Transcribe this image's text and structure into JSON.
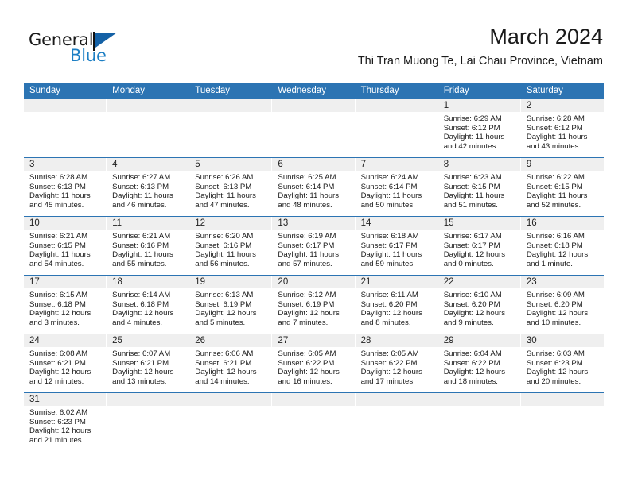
{
  "brand": {
    "name_top": "General",
    "name_bottom": "Blue",
    "accent_color": "#1d7fc4",
    "flag_color": "#1461a6"
  },
  "header": {
    "title": "March 2024",
    "subtitle": "Thi Tran Muong Te, Lai Chau Province, Vietnam",
    "header_bg": "#2c74b3",
    "daynum_bg": "#efefef"
  },
  "weekdays": [
    "Sunday",
    "Monday",
    "Tuesday",
    "Wednesday",
    "Thursday",
    "Friday",
    "Saturday"
  ],
  "weeks": [
    [
      {
        "day": "",
        "sunrise": "",
        "sunset": "",
        "daylight1": "",
        "daylight2": "",
        "empty": true
      },
      {
        "day": "",
        "sunrise": "",
        "sunset": "",
        "daylight1": "",
        "daylight2": "",
        "empty": true
      },
      {
        "day": "",
        "sunrise": "",
        "sunset": "",
        "daylight1": "",
        "daylight2": "",
        "empty": true
      },
      {
        "day": "",
        "sunrise": "",
        "sunset": "",
        "daylight1": "",
        "daylight2": "",
        "empty": true
      },
      {
        "day": "",
        "sunrise": "",
        "sunset": "",
        "daylight1": "",
        "daylight2": "",
        "empty": true
      },
      {
        "day": "1",
        "sunrise": "Sunrise: 6:29 AM",
        "sunset": "Sunset: 6:12 PM",
        "daylight1": "Daylight: 11 hours",
        "daylight2": "and 42 minutes."
      },
      {
        "day": "2",
        "sunrise": "Sunrise: 6:28 AM",
        "sunset": "Sunset: 6:12 PM",
        "daylight1": "Daylight: 11 hours",
        "daylight2": "and 43 minutes."
      }
    ],
    [
      {
        "day": "3",
        "sunrise": "Sunrise: 6:28 AM",
        "sunset": "Sunset: 6:13 PM",
        "daylight1": "Daylight: 11 hours",
        "daylight2": "and 45 minutes."
      },
      {
        "day": "4",
        "sunrise": "Sunrise: 6:27 AM",
        "sunset": "Sunset: 6:13 PM",
        "daylight1": "Daylight: 11 hours",
        "daylight2": "and 46 minutes."
      },
      {
        "day": "5",
        "sunrise": "Sunrise: 6:26 AM",
        "sunset": "Sunset: 6:13 PM",
        "daylight1": "Daylight: 11 hours",
        "daylight2": "and 47 minutes."
      },
      {
        "day": "6",
        "sunrise": "Sunrise: 6:25 AM",
        "sunset": "Sunset: 6:14 PM",
        "daylight1": "Daylight: 11 hours",
        "daylight2": "and 48 minutes."
      },
      {
        "day": "7",
        "sunrise": "Sunrise: 6:24 AM",
        "sunset": "Sunset: 6:14 PM",
        "daylight1": "Daylight: 11 hours",
        "daylight2": "and 50 minutes."
      },
      {
        "day": "8",
        "sunrise": "Sunrise: 6:23 AM",
        "sunset": "Sunset: 6:15 PM",
        "daylight1": "Daylight: 11 hours",
        "daylight2": "and 51 minutes."
      },
      {
        "day": "9",
        "sunrise": "Sunrise: 6:22 AM",
        "sunset": "Sunset: 6:15 PM",
        "daylight1": "Daylight: 11 hours",
        "daylight2": "and 52 minutes."
      }
    ],
    [
      {
        "day": "10",
        "sunrise": "Sunrise: 6:21 AM",
        "sunset": "Sunset: 6:15 PM",
        "daylight1": "Daylight: 11 hours",
        "daylight2": "and 54 minutes."
      },
      {
        "day": "11",
        "sunrise": "Sunrise: 6:21 AM",
        "sunset": "Sunset: 6:16 PM",
        "daylight1": "Daylight: 11 hours",
        "daylight2": "and 55 minutes."
      },
      {
        "day": "12",
        "sunrise": "Sunrise: 6:20 AM",
        "sunset": "Sunset: 6:16 PM",
        "daylight1": "Daylight: 11 hours",
        "daylight2": "and 56 minutes."
      },
      {
        "day": "13",
        "sunrise": "Sunrise: 6:19 AM",
        "sunset": "Sunset: 6:17 PM",
        "daylight1": "Daylight: 11 hours",
        "daylight2": "and 57 minutes."
      },
      {
        "day": "14",
        "sunrise": "Sunrise: 6:18 AM",
        "sunset": "Sunset: 6:17 PM",
        "daylight1": "Daylight: 11 hours",
        "daylight2": "and 59 minutes."
      },
      {
        "day": "15",
        "sunrise": "Sunrise: 6:17 AM",
        "sunset": "Sunset: 6:17 PM",
        "daylight1": "Daylight: 12 hours",
        "daylight2": "and 0 minutes."
      },
      {
        "day": "16",
        "sunrise": "Sunrise: 6:16 AM",
        "sunset": "Sunset: 6:18 PM",
        "daylight1": "Daylight: 12 hours",
        "daylight2": "and 1 minute."
      }
    ],
    [
      {
        "day": "17",
        "sunrise": "Sunrise: 6:15 AM",
        "sunset": "Sunset: 6:18 PM",
        "daylight1": "Daylight: 12 hours",
        "daylight2": "and 3 minutes."
      },
      {
        "day": "18",
        "sunrise": "Sunrise: 6:14 AM",
        "sunset": "Sunset: 6:18 PM",
        "daylight1": "Daylight: 12 hours",
        "daylight2": "and 4 minutes."
      },
      {
        "day": "19",
        "sunrise": "Sunrise: 6:13 AM",
        "sunset": "Sunset: 6:19 PM",
        "daylight1": "Daylight: 12 hours",
        "daylight2": "and 5 minutes."
      },
      {
        "day": "20",
        "sunrise": "Sunrise: 6:12 AM",
        "sunset": "Sunset: 6:19 PM",
        "daylight1": "Daylight: 12 hours",
        "daylight2": "and 7 minutes."
      },
      {
        "day": "21",
        "sunrise": "Sunrise: 6:11 AM",
        "sunset": "Sunset: 6:20 PM",
        "daylight1": "Daylight: 12 hours",
        "daylight2": "and 8 minutes."
      },
      {
        "day": "22",
        "sunrise": "Sunrise: 6:10 AM",
        "sunset": "Sunset: 6:20 PM",
        "daylight1": "Daylight: 12 hours",
        "daylight2": "and 9 minutes."
      },
      {
        "day": "23",
        "sunrise": "Sunrise: 6:09 AM",
        "sunset": "Sunset: 6:20 PM",
        "daylight1": "Daylight: 12 hours",
        "daylight2": "and 10 minutes."
      }
    ],
    [
      {
        "day": "24",
        "sunrise": "Sunrise: 6:08 AM",
        "sunset": "Sunset: 6:21 PM",
        "daylight1": "Daylight: 12 hours",
        "daylight2": "and 12 minutes."
      },
      {
        "day": "25",
        "sunrise": "Sunrise: 6:07 AM",
        "sunset": "Sunset: 6:21 PM",
        "daylight1": "Daylight: 12 hours",
        "daylight2": "and 13 minutes."
      },
      {
        "day": "26",
        "sunrise": "Sunrise: 6:06 AM",
        "sunset": "Sunset: 6:21 PM",
        "daylight1": "Daylight: 12 hours",
        "daylight2": "and 14 minutes."
      },
      {
        "day": "27",
        "sunrise": "Sunrise: 6:05 AM",
        "sunset": "Sunset: 6:22 PM",
        "daylight1": "Daylight: 12 hours",
        "daylight2": "and 16 minutes."
      },
      {
        "day": "28",
        "sunrise": "Sunrise: 6:05 AM",
        "sunset": "Sunset: 6:22 PM",
        "daylight1": "Daylight: 12 hours",
        "daylight2": "and 17 minutes."
      },
      {
        "day": "29",
        "sunrise": "Sunrise: 6:04 AM",
        "sunset": "Sunset: 6:22 PM",
        "daylight1": "Daylight: 12 hours",
        "daylight2": "and 18 minutes."
      },
      {
        "day": "30",
        "sunrise": "Sunrise: 6:03 AM",
        "sunset": "Sunset: 6:23 PM",
        "daylight1": "Daylight: 12 hours",
        "daylight2": "and 20 minutes."
      }
    ],
    [
      {
        "day": "31",
        "sunrise": "Sunrise: 6:02 AM",
        "sunset": "Sunset: 6:23 PM",
        "daylight1": "Daylight: 12 hours",
        "daylight2": "and 21 minutes."
      },
      {
        "day": "",
        "sunrise": "",
        "sunset": "",
        "daylight1": "",
        "daylight2": "",
        "empty": true
      },
      {
        "day": "",
        "sunrise": "",
        "sunset": "",
        "daylight1": "",
        "daylight2": "",
        "empty": true
      },
      {
        "day": "",
        "sunrise": "",
        "sunset": "",
        "daylight1": "",
        "daylight2": "",
        "empty": true
      },
      {
        "day": "",
        "sunrise": "",
        "sunset": "",
        "daylight1": "",
        "daylight2": "",
        "empty": true
      },
      {
        "day": "",
        "sunrise": "",
        "sunset": "",
        "daylight1": "",
        "daylight2": "",
        "empty": true
      },
      {
        "day": "",
        "sunrise": "",
        "sunset": "",
        "daylight1": "",
        "daylight2": "",
        "empty": true
      }
    ]
  ]
}
